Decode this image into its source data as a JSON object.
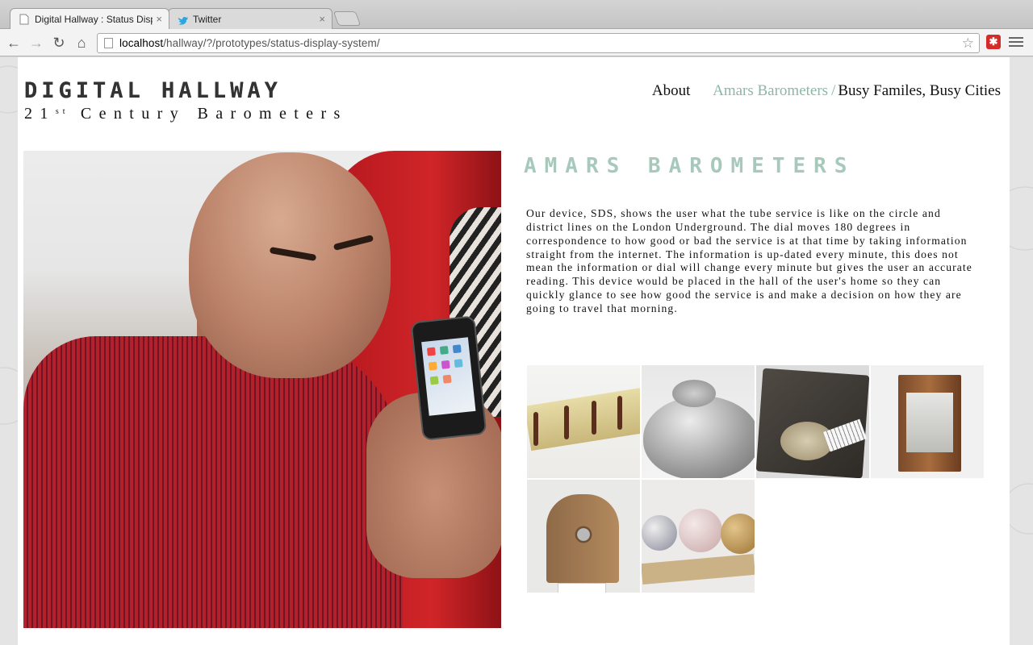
{
  "browser": {
    "tabs": [
      {
        "title": "Digital Hallway : Status Displ",
        "close": "×",
        "active": true
      },
      {
        "title": "Twitter",
        "close": "×",
        "active": false
      }
    ],
    "url_host": "localhost",
    "url_path": "/hallway/?/prototypes/status-display-system/",
    "nav": {
      "back": "←",
      "forward": "→",
      "reload": "↻",
      "home": "⌂"
    },
    "bookmark_icon": "star-icon",
    "extension_icon": "red-extension-icon"
  },
  "site": {
    "logo_title": "DIGITAL HALLWAY",
    "logo_sub_prefix": "21",
    "logo_sub_sup": "st",
    "logo_sub_rest": " Century Barometers",
    "nav": {
      "about": "About",
      "amars": "Amars Barometers",
      "separator": "/",
      "busy": "Busy Familes, Busy Cities"
    },
    "colors": {
      "accent": "#8ab8a4",
      "text": "#111111"
    }
  },
  "article": {
    "title": "AMARS BAROMETERS",
    "description": "Our device, SDS, shows the user what the tube service is like on the circle and district lines on the London Underground. The dial moves 180 degrees in correspondence to how good or bad the service is at that time by taking information straight from the internet. The information is up-dated every minute, this does not mean the information or dial will change every minute but gives the user an accurate reading. This device would be placed in the hall of the user's home so they can quickly glance to see how good the service is and make a decision on how they are going to travel that morning.",
    "thumbnail_count": 6
  }
}
